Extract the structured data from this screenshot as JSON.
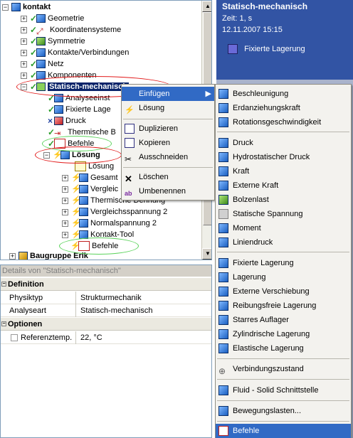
{
  "tree": {
    "root_label": "kontakt",
    "items": [
      {
        "label": "Geometrie"
      },
      {
        "label": "Koordinatensysteme"
      },
      {
        "label": "Symmetrie"
      },
      {
        "label": "Kontakte/Verbindungen"
      },
      {
        "label": "Netz"
      },
      {
        "label": "Komponenten"
      },
      {
        "label": "Statisch-mechanisch"
      },
      {
        "label": "Analyseeinst"
      },
      {
        "label": "Fixierte Lage"
      },
      {
        "label": "Druck"
      },
      {
        "label": "Thermische B"
      },
      {
        "label": "Befehle"
      },
      {
        "label": "Lösung"
      },
      {
        "label": "Lösung"
      },
      {
        "label": "Gesamt"
      },
      {
        "label": "Vergleic"
      },
      {
        "label": "Thermische Dehnung"
      },
      {
        "label": "Vergleichsspannung 2"
      },
      {
        "label": "Normalspannung 2"
      },
      {
        "label": "Kontakt-Tool"
      },
      {
        "label": "Befehle"
      },
      {
        "label": "Baugruppe Erik"
      }
    ]
  },
  "header": {
    "title": "Statisch-mechanisch",
    "time": "Zeit: 1, s",
    "date": "12.11.2007 15:15",
    "legend_label": "Fixierte Lagerung",
    "legend_color": "#6a6ad8"
  },
  "context_menu": {
    "items": [
      {
        "label": "Einfügen"
      },
      {
        "label": "Lösung"
      },
      {
        "label": "Duplizieren"
      },
      {
        "label": "Kopieren"
      },
      {
        "label": "Ausschneiden"
      },
      {
        "label": "Löschen"
      },
      {
        "label": "Umbenennen"
      }
    ]
  },
  "submenu": {
    "items": [
      {
        "label": "Beschleunigung"
      },
      {
        "label": "Erdanziehungskraft"
      },
      {
        "label": "Rotationsgeschwindigkeit"
      },
      {
        "label": "Druck"
      },
      {
        "label": "Hydrostatischer Druck"
      },
      {
        "label": "Kraft"
      },
      {
        "label": "Externe Kraft"
      },
      {
        "label": "Bolzenlast"
      },
      {
        "label": "Statische Spannung"
      },
      {
        "label": "Moment"
      },
      {
        "label": "Liniendruck"
      },
      {
        "label": "Fixierte Lagerung"
      },
      {
        "label": "Lagerung"
      },
      {
        "label": "Externe Verschiebung"
      },
      {
        "label": "Reibungsfreie Lagerung"
      },
      {
        "label": "Starres Auflager"
      },
      {
        "label": "Zylindrische Lagerung"
      },
      {
        "label": "Elastische Lagerung"
      },
      {
        "label": "Verbindungszustand"
      },
      {
        "label": "Fluid - Solid Schnittstelle"
      },
      {
        "label": "Bewegungslasten..."
      },
      {
        "label": "Befehle"
      }
    ]
  },
  "details": {
    "title": "Details von \"Statisch-mechanisch\"",
    "section1": "Definition",
    "rows1": [
      {
        "key": "Physiktyp",
        "value": "Strukturmechanik"
      },
      {
        "key": "Analyseart",
        "value": "Statisch-mechanisch"
      }
    ],
    "section2": "Optionen",
    "rows2": [
      {
        "key": "Referenztemp.",
        "value": "22, °C"
      }
    ]
  }
}
